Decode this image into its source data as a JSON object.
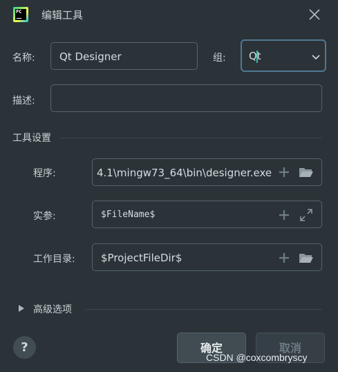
{
  "window": {
    "app_logo_text": "PC",
    "title": "编辑工具",
    "close_icon": "close-icon"
  },
  "form": {
    "name_label": "名称:",
    "name_value": "Qt Designer",
    "group_label": "组:",
    "group_value": "Qt",
    "description_label": "描述:",
    "description_value": ""
  },
  "tool_settings": {
    "section_title": "工具设置",
    "program_label": "程序:",
    "program_value": "4.1\\mingw73_64\\bin\\designer.exe",
    "arguments_label": "实参:",
    "arguments_value": "$FileName$",
    "workdir_label": "工作目录:",
    "workdir_value": "$ProjectFileDir$"
  },
  "advanced": {
    "label": "高级选项"
  },
  "footer": {
    "help_label": "?",
    "ok_label": "确定",
    "cancel_label": "取消"
  },
  "watermark": "CSDN @coxcombryscy",
  "colors": {
    "background": "#2b3338",
    "border": "#56646d",
    "focus_border": "#4f7993",
    "caret": "#2ec4a6"
  }
}
